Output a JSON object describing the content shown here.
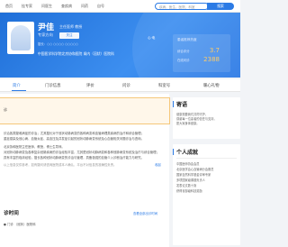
{
  "topnav": {
    "items": [
      "首页",
      "挂专家",
      "问医生",
      "查疾病",
      "问药",
      "自号"
    ],
    "search_placeholder": "疾病、医生、医院、科室",
    "search_button": "搜索"
  },
  "doctor": {
    "name": "尹佳",
    "title": "主任医师  教授",
    "department": "专家方向",
    "follow_label": "关注",
    "tags": "擅长：○○ ○○○○  ○○○○○",
    "hospital": "中国医学科学院北京协和医院  肾内（冠状）医院科"
  },
  "rating": {
    "header": "患者推荐热度",
    "score_label": "综合评分",
    "score": "3.7",
    "count_label": "在线问诊",
    "count": "2388"
  },
  "hero_right_text": "心·电",
  "tabs": [
    {
      "label": "简介",
      "active": true
    },
    {
      "label": "门诊信息",
      "active": false
    },
    {
      "label": "评价",
      "active": false
    },
    {
      "label": "问诊",
      "active": false
    },
    {
      "label": "科室号",
      "active": false
    },
    {
      "label": "暖心礼物",
      "active": false
    }
  ],
  "alert": {
    "label": "诊"
  },
  "intro": {
    "para1": [
      "诊治各类疑难病症的诊治；尤其擅长对于冠状动脉病变的各种病变和血管病理类疾病的治疗和综合管理；",
      "重症感染及冠心病、血管炎症、高血压及并发症引起的冠状动脉病变系统及心血管相关问题诊治与咨询。"
    ],
    "para2": [
      "北京协和医院主任医师、教授，博士生导师。",
      "对冠状动脉病变及各种复杂冠脉疾病的诊治经验丰富，尤其是冠状动脉病变和各种冠脉病变系统及治疗与综合管理；",
      "具有丰富的临床经验，擅长各种冠状动脉病变的诊治与管理，具备极强的血管介入诊断治疗能力与研究。"
    ],
    "more_note": "以上信息仅供参考，如有疑问请咨询医院或本人确认，平台不对信息的准确性负责。",
    "more_link": "收起"
  },
  "schedule": {
    "title": "诊时间",
    "link": "查看全部出诊时间",
    "row": "● 门诊 （冠状）医院科"
  },
  "sidebar": {
    "card1_title": "寄语",
    "card1_lines": [
      "健康需要我们共同守护，",
      "感谢每一位患者的信任与支持，",
      "愿大家身体健康。"
    ],
    "card2_title": "个人成就",
    "card2_lines": [
      "中国医师协会会员",
      "北京医学会心血管病分会委员",
      "国家自然科学基金评审专家",
      "多项国家级课题负责人",
      "发表论文数十篇",
      "获得省部级科技奖励"
    ]
  }
}
